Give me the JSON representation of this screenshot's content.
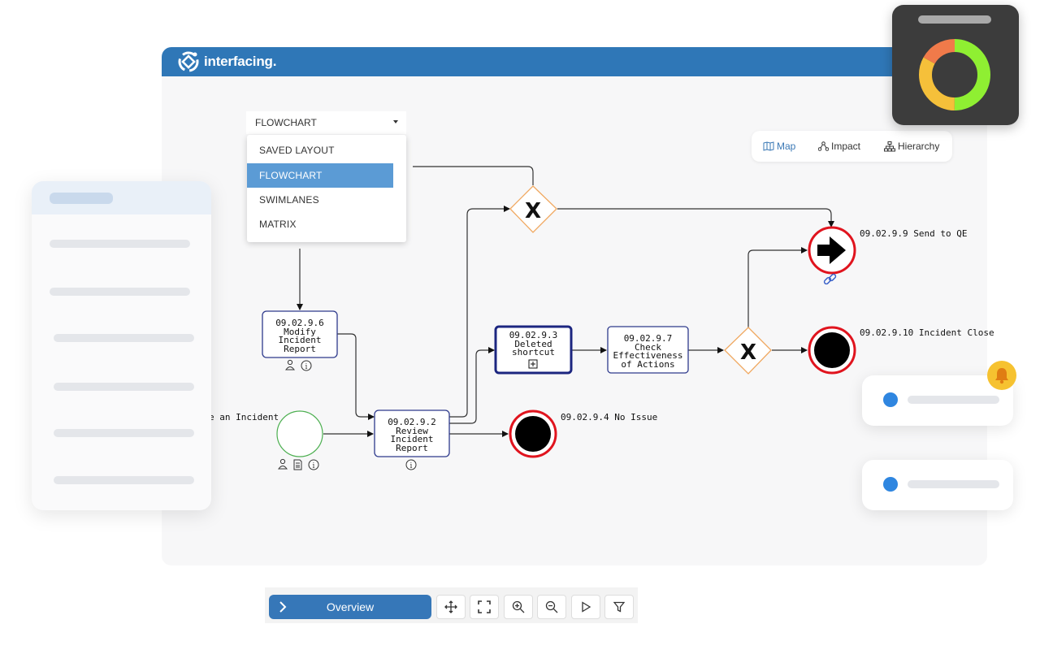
{
  "header": {
    "brand": "interfacing."
  },
  "layout_select": {
    "selected": "FLOWCHART",
    "options": [
      "SAVED LAYOUT",
      "FLOWCHART",
      "SWIMLANES",
      "MATRIX"
    ],
    "highlighted_index": 1
  },
  "view_tabs": [
    {
      "label": "Map",
      "icon": "map-icon",
      "active": true
    },
    {
      "label": "Impact",
      "icon": "impact-icon",
      "active": false
    },
    {
      "label": "Hierarchy",
      "icon": "hierarchy-icon",
      "active": false
    }
  ],
  "diagram": {
    "nodes": {
      "modify": {
        "lines": [
          "09.02.9.6",
          "Modify",
          "Incident",
          "Report"
        ]
      },
      "review": {
        "lines": [
          "09.02.9.2",
          "Review",
          "Incident",
          "Report"
        ]
      },
      "deleted": {
        "lines": [
          "09.02.9.3",
          "Deleted",
          "shortcut"
        ]
      },
      "check": {
        "lines": [
          "09.02.9.7",
          "Check",
          "Effectiveness",
          "of Actions"
        ]
      }
    },
    "labels": {
      "send_to_qe": "09.02.9.9 Send to QE",
      "incident_close": "09.02.9.10 Incident Close",
      "no_issue": "09.02.9.4 No Issue",
      "start_event": "e an Incident"
    }
  },
  "toolbar": {
    "overview_label": "Overview",
    "buttons": [
      "move-icon",
      "fullscreen-icon",
      "zoom-in-icon",
      "zoom-out-icon",
      "play-icon",
      "filter-icon"
    ]
  },
  "colors": {
    "header": "#2f77b7",
    "accent": "#5b9bd5",
    "end_event": "#e0141e",
    "gateway": "#f0a860",
    "start_event": "#4caf50",
    "task_border": "#2e3a8c",
    "donut": [
      "#8fef32",
      "#f5c03a",
      "#f07a4a"
    ]
  },
  "donut_widget": {
    "segments": [
      0.5,
      0.33,
      0.17
    ]
  }
}
